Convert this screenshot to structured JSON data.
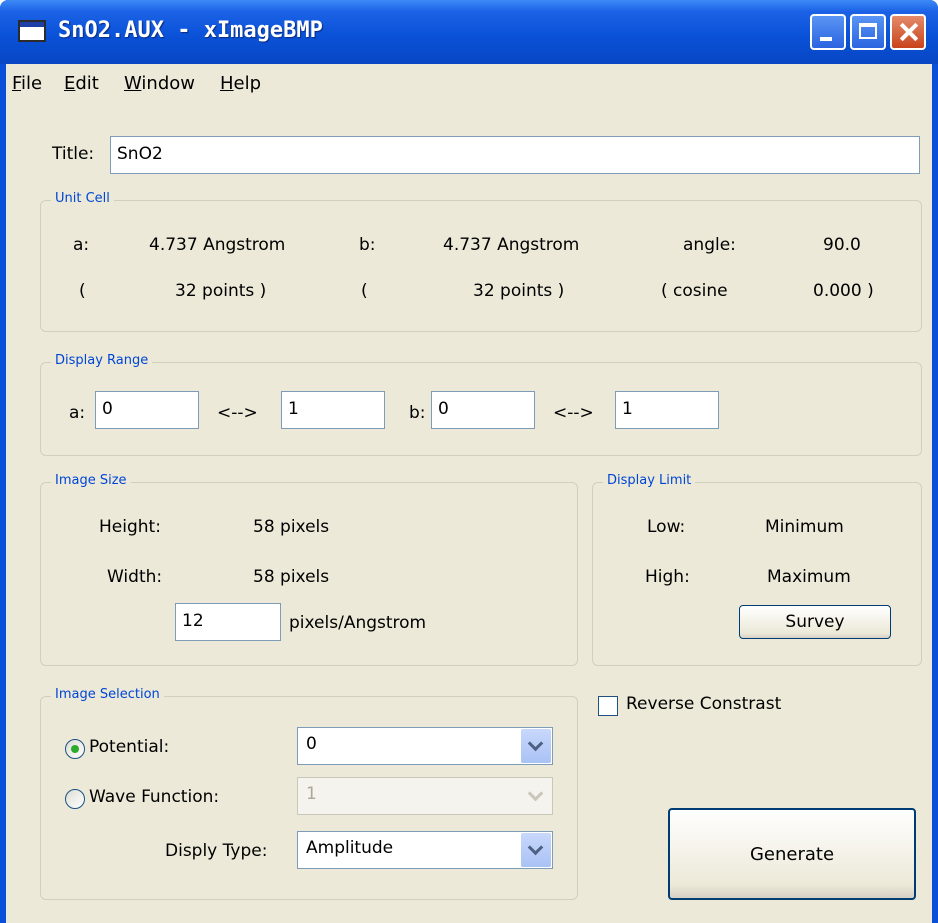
{
  "window": {
    "title": "SnO2.AUX - xImageBMP"
  },
  "menu": [
    {
      "ul": "F",
      "rest": "ile"
    },
    {
      "ul": "E",
      "rest": "dit"
    },
    {
      "ul": "W",
      "rest": "indow"
    },
    {
      "ul": "H",
      "rest": "elp"
    }
  ],
  "title_field": {
    "label": "Title:",
    "value": "SnO2"
  },
  "unit_cell": {
    "legend": "Unit Cell",
    "a_label": "a:",
    "a_value": "4.737 Angstrom",
    "b_label": "b:",
    "b_value": "4.737 Angstrom",
    "angle_label": "angle:",
    "angle_value": "90.0",
    "a_points_open": "(",
    "a_points": "32  points )",
    "b_points_open": "(",
    "b_points": "32  points )",
    "cosine_label": "( cosine",
    "cosine_value": "0.000 )"
  },
  "display_range": {
    "legend": "Display Range",
    "a_label": "a:",
    "a_from": "0",
    "a_arrow": "<-->",
    "a_to": "1",
    "b_label": "b:",
    "b_from": "0",
    "b_arrow": "<-->",
    "b_to": "1"
  },
  "image_size": {
    "legend": "Image Size",
    "height_label": "Height:",
    "height_value": "58 pixels",
    "width_label": "Width:",
    "width_value": "58 pixels",
    "ppa_value": "12",
    "ppa_unit": "pixels/Angstrom"
  },
  "display_limit": {
    "legend": "Display Limit",
    "low_label": "Low:",
    "low_value": "Minimum",
    "high_label": "High:",
    "high_value": "Maximum",
    "survey_label": "Survey"
  },
  "reverse_contrast": {
    "label": "Reverse Constrast",
    "checked": false
  },
  "image_selection": {
    "legend": "Image Selection",
    "potential_label": "Potential:",
    "potential_value": "0",
    "potential_selected": true,
    "wave_label": "Wave Function:",
    "wave_value": "1",
    "wave_selected": false,
    "disply_type_label": "Disply Type:",
    "disply_type_value": "Amplitude"
  },
  "generate_label": "Generate",
  "colors": {
    "titlebar": "#0a52d8",
    "client_bg": "#ece9d8",
    "legend": "#0046d5"
  },
  "icons": [
    "app-window-icon",
    "minimize-icon",
    "maximize-icon",
    "close-icon",
    "chevron-down-icon"
  ]
}
